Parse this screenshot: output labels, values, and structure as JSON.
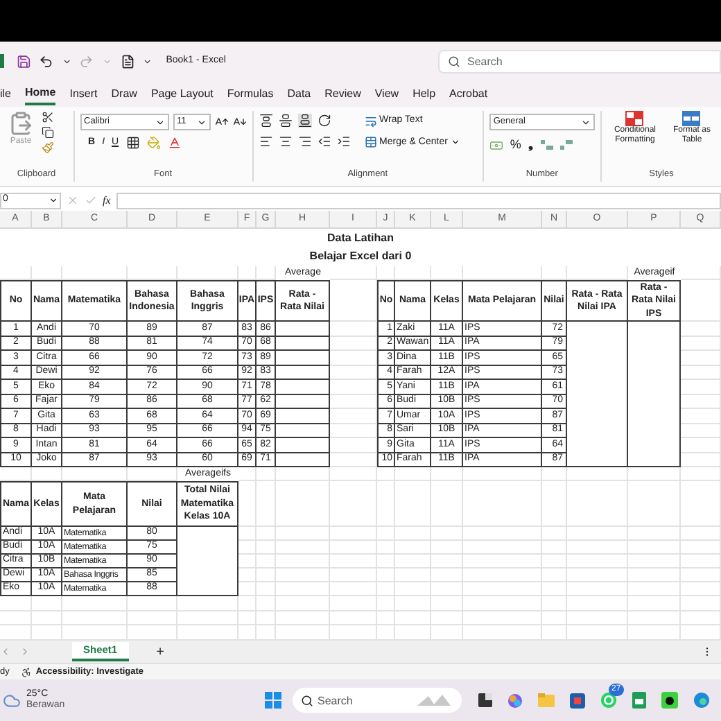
{
  "title_bar": {
    "title": "Book1 - Excel",
    "search": {
      "placeholder": "Search"
    }
  },
  "ribbon_tabs": [
    {
      "label": "ile",
      "selected": false
    },
    {
      "label": "Home",
      "selected": true
    },
    {
      "label": "Insert",
      "selected": false
    },
    {
      "label": "Draw",
      "selected": false
    },
    {
      "label": "Page Layout",
      "selected": false
    },
    {
      "label": "Formulas",
      "selected": false
    },
    {
      "label": "Data",
      "selected": false
    },
    {
      "label": "Review",
      "selected": false
    },
    {
      "label": "View",
      "selected": false
    },
    {
      "label": "Help",
      "selected": false
    },
    {
      "label": "Acrobat",
      "selected": false
    }
  ],
  "ribbon": {
    "paste": "Paste",
    "font": "Calibri",
    "font_size": "11",
    "bold": "B",
    "italic": "I",
    "underline": "U",
    "wrap_text": "Wrap Text",
    "merge": "Merge & Center",
    "number_format": "General",
    "percent": "%",
    "comma": "❟",
    "conditional_formatting": "Conditional Formatting",
    "format_as_table": "Format as Table",
    "groups": [
      "Clipboard",
      "Font",
      "Alignment",
      "Number",
      "Styles"
    ]
  },
  "formula_bar": {
    "name_box": "0",
    "fx": "fx"
  },
  "columns": [
    "A",
    "B",
    "C",
    "D",
    "E",
    "F",
    "G",
    "H",
    "I",
    "J",
    "K",
    "L",
    "M",
    "N",
    "O",
    "P",
    "Q"
  ],
  "sheet": {
    "title": "Data Latihan",
    "subtitle": "Belajar Excel dari 0",
    "label_average": "Average",
    "label_averageif": "Averageif",
    "label_averageifs": "Averageifs",
    "table_1": {
      "columns": [
        "No",
        "Nama",
        "Matematika",
        "Bahasa Indonesia",
        "Bahasa Inggris",
        "IPA",
        "IPS",
        "Rata - Rata Nilai"
      ],
      "rows": [
        [
          "1",
          "Andi",
          "70",
          "89",
          "87",
          "83",
          "86"
        ],
        [
          "2",
          "Budi",
          "88",
          "81",
          "74",
          "70",
          "68"
        ],
        [
          "3",
          "Citra",
          "66",
          "90",
          "72",
          "73",
          "89"
        ],
        [
          "4",
          "Dewi",
          "92",
          "76",
          "66",
          "92",
          "83"
        ],
        [
          "5",
          "Eko",
          "84",
          "72",
          "90",
          "71",
          "78"
        ],
        [
          "6",
          "Fajar",
          "79",
          "86",
          "68",
          "77",
          "62"
        ],
        [
          "7",
          "Gita",
          "63",
          "68",
          "64",
          "70",
          "69"
        ],
        [
          "8",
          "Hadi",
          "93",
          "95",
          "66",
          "94",
          "75"
        ],
        [
          "9",
          "Intan",
          "81",
          "64",
          "66",
          "65",
          "82"
        ],
        [
          "10",
          "Joko",
          "87",
          "93",
          "60",
          "69",
          "71"
        ]
      ]
    },
    "table_2": {
      "columns": [
        "No",
        "Nama",
        "Kelas",
        "Mata Pelajaran",
        "Nilai",
        "Rata - Rata Nilai IPA",
        "Rata - Rata Nilai IPS"
      ],
      "rows": [
        [
          "1",
          "Zaki",
          "11A",
          "IPS",
          "72"
        ],
        [
          "2",
          "Wawan",
          "11A",
          "IPA",
          "79"
        ],
        [
          "3",
          "Dina",
          "11B",
          "IPS",
          "65"
        ],
        [
          "4",
          "Farah",
          "12A",
          "IPS",
          "73"
        ],
        [
          "5",
          "Yani",
          "11B",
          "IPA",
          "61"
        ],
        [
          "6",
          "Budi",
          "10B",
          "IPS",
          "70"
        ],
        [
          "7",
          "Umar",
          "10A",
          "IPS",
          "87"
        ],
        [
          "8",
          "Sari",
          "10B",
          "IPA",
          "81"
        ],
        [
          "9",
          "Gita",
          "11A",
          "IPS",
          "64"
        ],
        [
          "10",
          "Farah",
          "11B",
          "IPA",
          "87"
        ]
      ]
    },
    "table_3": {
      "columns": [
        "Nama",
        "Kelas",
        "Mata Pelajaran",
        "Nilai",
        "Total Nilai Matematika Kelas 10A"
      ],
      "rows": [
        [
          "Andi",
          "10A",
          "Matematika",
          "80"
        ],
        [
          "Budi",
          "10A",
          "Matematika",
          "75"
        ],
        [
          "Citra",
          "10B",
          "Matematika",
          "90"
        ],
        [
          "Dewi",
          "10A",
          "Bahasa Inggris",
          "85"
        ],
        [
          "Eko",
          "10A",
          "Matematika",
          "88"
        ]
      ]
    }
  },
  "sheet_tabs": [
    {
      "label": "Sheet1",
      "selected": true
    }
  ],
  "add_sheet": "+",
  "status_bar": {
    "ready": "dy",
    "accessibility": "Accessibility: Investigate"
  },
  "taskbar": {
    "temperature": "25°C",
    "weather": "Berawan",
    "search": {
      "placeholder": "Search"
    },
    "whatsapp_badge": "27"
  }
}
